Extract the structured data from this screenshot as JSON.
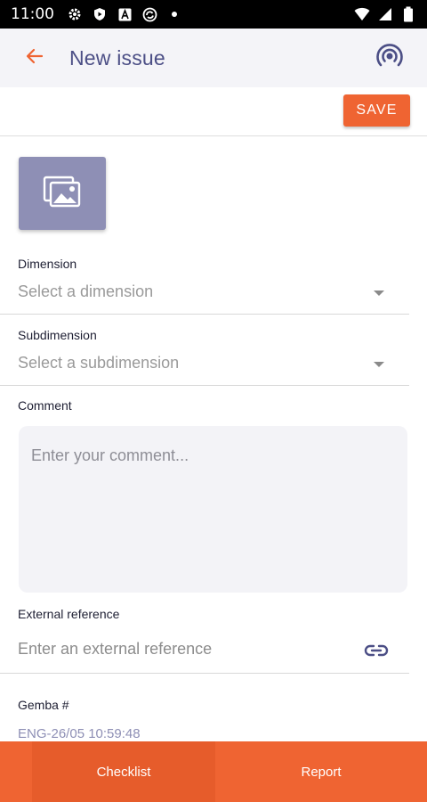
{
  "status_bar": {
    "time": "11:00",
    "left_icons": [
      "gear-icon",
      "shield-icon",
      "font-icon",
      "sync-icon",
      "dot-icon"
    ],
    "right_icons": [
      "wifi-icon",
      "signal-icon",
      "battery-icon"
    ]
  },
  "app_bar": {
    "title": "New issue",
    "back_icon": "arrow-left-icon",
    "action_icon": "broadcast-icon"
  },
  "toolbar": {
    "save_label": "SAVE"
  },
  "form": {
    "image_icon": "images-icon",
    "dimension": {
      "label": "Dimension",
      "placeholder": "Select a dimension"
    },
    "subdimension": {
      "label": "Subdimension",
      "placeholder": "Select a subdimension"
    },
    "comment": {
      "label": "Comment",
      "placeholder": "Enter your comment..."
    },
    "external_reference": {
      "label": "External reference",
      "placeholder": "Enter an external reference",
      "icon": "link-icon"
    },
    "gemba": {
      "label": "Gemba #",
      "value": "ENG-26/05 10:59:48"
    }
  },
  "bottom_nav": {
    "tabs": [
      {
        "label": "Checklist",
        "active": true
      },
      {
        "label": "Report",
        "active": false
      }
    ]
  },
  "colors": {
    "accent": "#ef6432",
    "title": "#4c4f86",
    "image_tile": "#8e8fb5"
  }
}
